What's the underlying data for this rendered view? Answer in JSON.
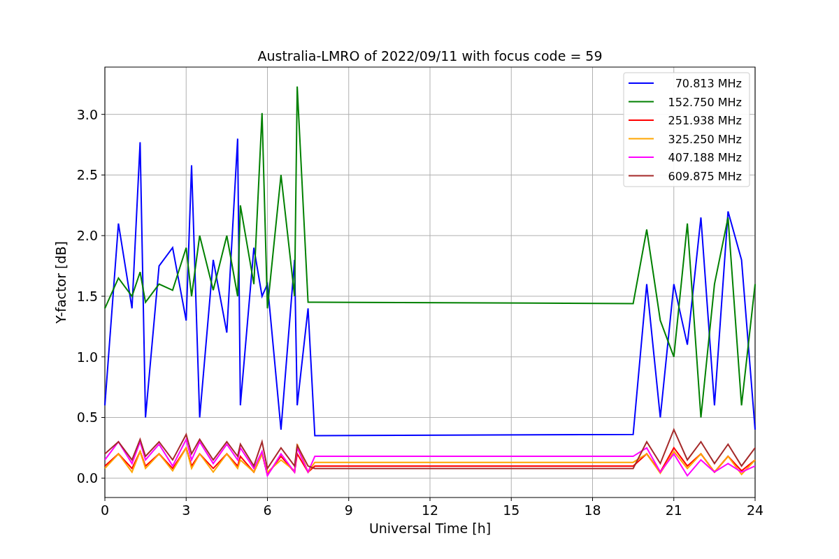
{
  "chart_data": {
    "type": "line",
    "title": "Australia-LMRO of 2022/09/11 with focus code = 59",
    "xlabel": "Universal Time [h]",
    "ylabel": "Y-factor [dB]",
    "x": [
      0,
      0.5,
      1,
      1.3,
      1.5,
      2,
      2.5,
      3,
      3.2,
      3.5,
      4,
      4.5,
      4.9,
      5,
      5.5,
      5.8,
      6,
      6.5,
      7,
      7.1,
      7.5,
      7.75,
      19.5,
      20,
      20.5,
      21,
      21.5,
      22,
      22.5,
      23,
      23.5,
      24
    ],
    "series": [
      {
        "name": "70.813 MHz",
        "color": "#0000ff",
        "values": [
          0.6,
          2.1,
          1.4,
          2.77,
          0.5,
          1.75,
          1.9,
          1.3,
          2.58,
          0.5,
          1.8,
          1.2,
          2.8,
          0.6,
          1.9,
          1.5,
          1.6,
          0.4,
          1.8,
          0.6,
          1.4,
          0.35,
          0.36,
          1.6,
          0.5,
          1.6,
          1.1,
          2.15,
          0.6,
          2.2,
          1.8,
          0.4
        ]
      },
      {
        "name": "152.750 MHz",
        "color": "#008000",
        "values": [
          1.4,
          1.65,
          1.5,
          1.7,
          1.45,
          1.6,
          1.55,
          1.9,
          1.5,
          2.0,
          1.55,
          2.0,
          1.5,
          2.25,
          1.6,
          3.01,
          1.4,
          2.5,
          1.5,
          3.23,
          1.45,
          1.45,
          1.44,
          2.05,
          1.3,
          1.0,
          2.1,
          0.5,
          1.6,
          2.15,
          0.6,
          1.6
        ]
      },
      {
        "name": "251.938 MHz",
        "color": "#ff0000",
        "values": [
          0.1,
          0.2,
          0.08,
          0.22,
          0.1,
          0.2,
          0.08,
          0.25,
          0.1,
          0.2,
          0.08,
          0.2,
          0.1,
          0.18,
          0.05,
          0.2,
          0.03,
          0.18,
          0.05,
          0.2,
          0.05,
          0.1,
          0.1,
          0.2,
          0.05,
          0.25,
          0.1,
          0.2,
          0.05,
          0.18,
          0.06,
          0.15
        ]
      },
      {
        "name": "325.250 MHz",
        "color": "#ffa500",
        "values": [
          0.08,
          0.2,
          0.05,
          0.22,
          0.08,
          0.2,
          0.06,
          0.25,
          0.08,
          0.2,
          0.05,
          0.2,
          0.08,
          0.15,
          0.05,
          0.2,
          0.05,
          0.15,
          0.06,
          0.28,
          0.05,
          0.13,
          0.13,
          0.2,
          0.04,
          0.22,
          0.08,
          0.2,
          0.05,
          0.18,
          0.03,
          0.15
        ]
      },
      {
        "name": "407.188 MHz",
        "color": "#ff00ff",
        "values": [
          0.15,
          0.3,
          0.12,
          0.3,
          0.15,
          0.28,
          0.1,
          0.32,
          0.15,
          0.3,
          0.12,
          0.28,
          0.15,
          0.25,
          0.08,
          0.22,
          0.02,
          0.2,
          0.05,
          0.25,
          0.05,
          0.18,
          0.18,
          0.25,
          0.05,
          0.2,
          0.02,
          0.15,
          0.05,
          0.12,
          0.05,
          0.1
        ]
      },
      {
        "name": "609.875 MHz",
        "color": "#a52a2a",
        "values": [
          0.2,
          0.3,
          0.15,
          0.32,
          0.18,
          0.3,
          0.15,
          0.36,
          0.2,
          0.32,
          0.15,
          0.3,
          0.18,
          0.28,
          0.1,
          0.3,
          0.08,
          0.25,
          0.1,
          0.27,
          0.1,
          0.08,
          0.08,
          0.3,
          0.12,
          0.4,
          0.15,
          0.3,
          0.12,
          0.28,
          0.1,
          0.25
        ]
      }
    ],
    "grid": true,
    "legend": true,
    "xlim": [
      0,
      24
    ],
    "ylim": [
      -0.16,
      3.39
    ],
    "xticks": [
      0,
      3,
      6,
      9,
      12,
      15,
      18,
      21,
      24
    ],
    "yticks": [
      {
        "value": 0,
        "label": "0.0"
      },
      {
        "value": 0.5,
        "label": "0.5"
      },
      {
        "value": 1,
        "label": "1.0"
      },
      {
        "value": 1.5,
        "label": "1.5"
      },
      {
        "value": 2,
        "label": "2.0"
      },
      {
        "value": 2.5,
        "label": "2.5"
      },
      {
        "value": 3,
        "label": "3.0"
      }
    ]
  }
}
